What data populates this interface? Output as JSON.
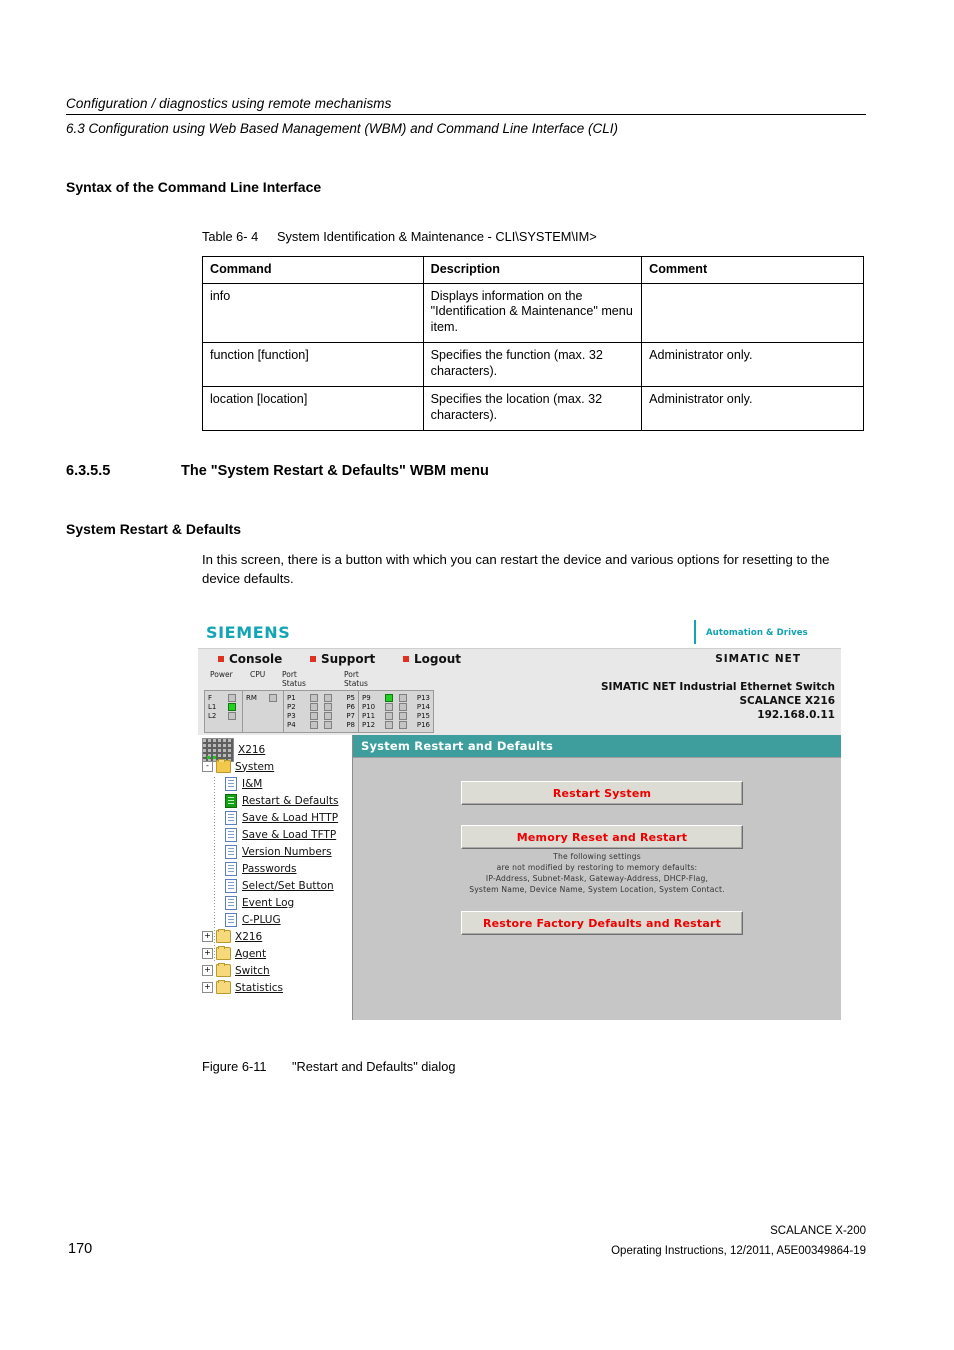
{
  "running_head": {
    "chapter": "Configuration / diagnostics using remote mechanisms",
    "section": "6.3 Configuration using Web Based Management (WBM) and Command Line Interface (CLI)"
  },
  "headings": {
    "syntax": "Syntax of the Command Line Interface",
    "numbered_number": "6.3.5.5",
    "numbered_title": "The \"System Restart & Defaults\" WBM menu",
    "subsection": "System Restart & Defaults"
  },
  "body_paragraph": "In this screen, there is a button with which you can restart the device and various options for resetting to the device defaults.",
  "table_caption": {
    "label": "Table 6- 4",
    "text": "System Identification & Maintenance - CLI\\SYSTEM\\IM>"
  },
  "table": {
    "headers": [
      "Command",
      "Description",
      "Comment"
    ],
    "rows": [
      {
        "command": "info",
        "description": "Displays information on the \"Identification & Maintenance\" menu item.",
        "comment": ""
      },
      {
        "command": "function [function]",
        "description": "Specifies the function (max. 32 characters).",
        "comment": "Administrator only."
      },
      {
        "command": "location [location]",
        "description": "Specifies the location (max. 32 characters).",
        "comment": "Administrator only."
      }
    ]
  },
  "wbm": {
    "brand": "SIEMENS",
    "brand_tagline": "Automation & Drives",
    "menu": [
      {
        "label": "Console"
      },
      {
        "label": "Support"
      },
      {
        "label": "Logout"
      }
    ],
    "product_line": "SIMATIC NET",
    "led_panel": {
      "group_labels": {
        "power": "Power",
        "cpu": "CPU",
        "port1": "Port",
        "port1_sub": "Status",
        "port2": "Port",
        "port2_sub": "Status"
      },
      "power": [
        {
          "name": "F",
          "state": "off"
        },
        {
          "name": "L1",
          "state": "on"
        },
        {
          "name": "L2",
          "state": "off"
        }
      ],
      "cpu": [
        {
          "name": "RM",
          "state": "off"
        }
      ],
      "ports_left": [
        {
          "left": "P1",
          "right": "P5",
          "led1": "off",
          "led2": "off"
        },
        {
          "left": "P2",
          "right": "P6",
          "led1": "off",
          "led2": "off"
        },
        {
          "left": "P3",
          "right": "P7",
          "led1": "off",
          "led2": "off"
        },
        {
          "left": "P4",
          "right": "P8",
          "led1": "off",
          "led2": "off"
        }
      ],
      "ports_right": [
        {
          "left": "P9",
          "right": "P13",
          "led1": "on",
          "led2": "off"
        },
        {
          "left": "P10",
          "right": "P14",
          "led1": "off",
          "led2": "off"
        },
        {
          "left": "P11",
          "right": "P15",
          "led1": "off",
          "led2": "off"
        },
        {
          "left": "P12",
          "right": "P16",
          "led1": "off",
          "led2": "off"
        }
      ]
    },
    "device": {
      "line1": "SIMATIC NET Industrial Ethernet Switch",
      "line2": "SCALANCE X216",
      "line3": "192.168.0.11"
    },
    "tree": {
      "root": "X216",
      "system_label": "System",
      "system_children": [
        "I&M",
        "Restart & Defaults",
        "Save & Load HTTP",
        "Save & Load TFTP",
        "Version Numbers",
        "Passwords",
        "Select/Set Button",
        "Event Log",
        "C-PLUG"
      ],
      "active_child": "Restart & Defaults",
      "folders": [
        "X216",
        "Agent",
        "Switch",
        "Statistics"
      ],
      "expand_collapse": {
        "collapsed": "+",
        "expanded": "-"
      }
    },
    "content": {
      "header": "System Restart and Defaults",
      "buttons": {
        "restart_system": "Restart System",
        "memory_reset": "Memory Reset and Restart",
        "factory_restore": "Restore Factory Defaults and Restart"
      },
      "fineprint": [
        "The following settings",
        "are not modified by restoring to memory defaults:",
        "IP-Address, Subnet-Mask, Gateway-Address, DHCP-Flag,",
        "System Name, Device Name, System Location, System Contact."
      ]
    },
    "colors": {
      "brand_teal": "#12a5b4",
      "content_header_teal": "#3e9e9e",
      "button_text_red": "#ee0000",
      "led_on_green": "#24d024",
      "menu_marker_red": "#e03020"
    }
  },
  "figure_caption": {
    "label": "Figure 6-11",
    "text": "\"Restart and Defaults\" dialog"
  },
  "footer": {
    "page_number": "170",
    "line1": "SCALANCE X-200",
    "line2": "Operating Instructions, 12/2011, A5E00349864-19"
  }
}
